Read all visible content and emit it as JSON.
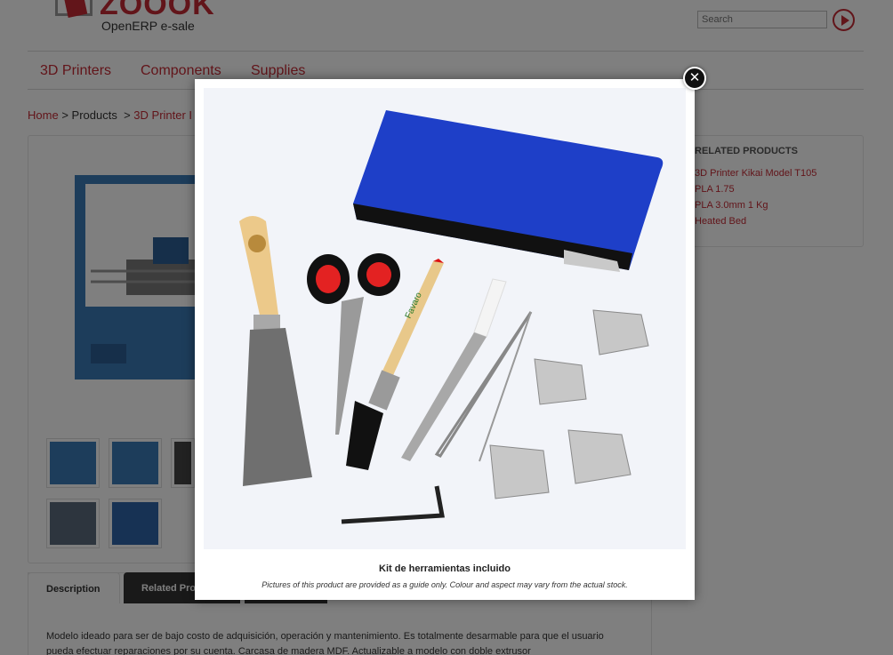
{
  "header": {
    "logo_word": "ZOOOK",
    "logo_sub": "OpenERP e-sale",
    "search_placeholder": "Search"
  },
  "nav": {
    "items": [
      "3D Printers",
      "Components",
      "Supplies"
    ]
  },
  "breadcrumb": {
    "home": "Home",
    "sep1": ">",
    "products": "Products",
    "sep2": ">",
    "current": "3D Printer I"
  },
  "related": {
    "title": "RELATED PRODUCTS",
    "items": [
      "3D Printer Kikai Model T105",
      "PLA 1.75",
      "PLA 3.0mm 1 Kg",
      "Heated Bed"
    ]
  },
  "tabs": {
    "description": "Description",
    "related": "Related Pro"
  },
  "description_text": "Modelo ideado para ser de bajo costo de adquisición, operación y mantenimiento. Es totalmente desarmable para que el usuario pueda efectuar reparaciones por su cuenta. Carcasa de madera MDF. Actualizable a modelo con doble extrusor",
  "lightbox": {
    "caption_title": "Kit de herramientas incluido",
    "caption_note": "Pictures of this product are provided as a guide only. Colour and aspect may vary from the actual stock.",
    "close_symbol": "✕",
    "brush_brand": "Favaro"
  },
  "colors": {
    "brand": "#c42a35",
    "pouch_blue": "#1e3fc8",
    "printer_blue": "#3b7bb7"
  }
}
